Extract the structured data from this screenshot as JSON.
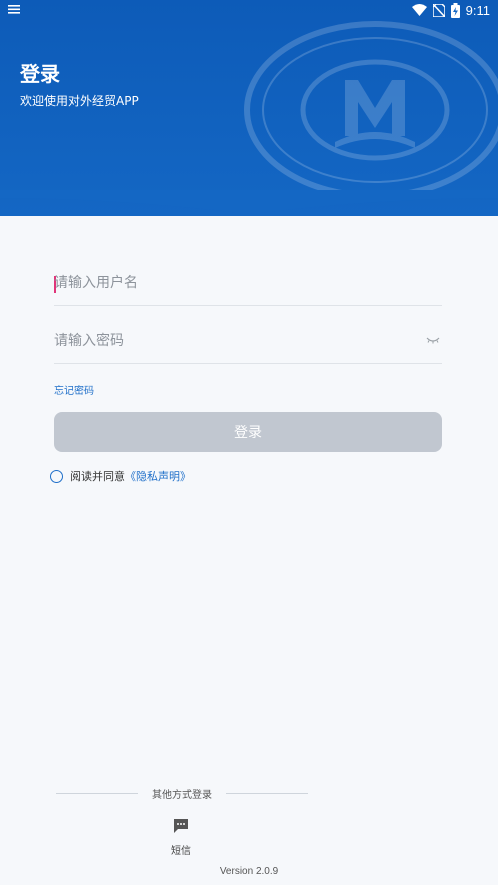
{
  "status_bar": {
    "time": "9:11",
    "icons": [
      "menu-icon",
      "wifi-icon",
      "no-sim-icon",
      "battery-charging-icon"
    ]
  },
  "header": {
    "title": "登录",
    "subtitle": "欢迎使用对外经贸APP",
    "background_color": "#0d5bb8"
  },
  "form": {
    "username_placeholder": "请输入用户名",
    "password_placeholder": "请输入密码",
    "forgot_password": "忘记密码",
    "login_button": "登录",
    "login_button_color": "#c1c7d0",
    "agree_text": "阅读并同意",
    "privacy_link": "《隐私声明》",
    "accent_color": "#1f6fc9"
  },
  "other_login": {
    "label": "其他方式登录",
    "sms_label": "短信",
    "sms_icon": "chat-bubble-icon"
  },
  "version": "Version 2.0.9"
}
